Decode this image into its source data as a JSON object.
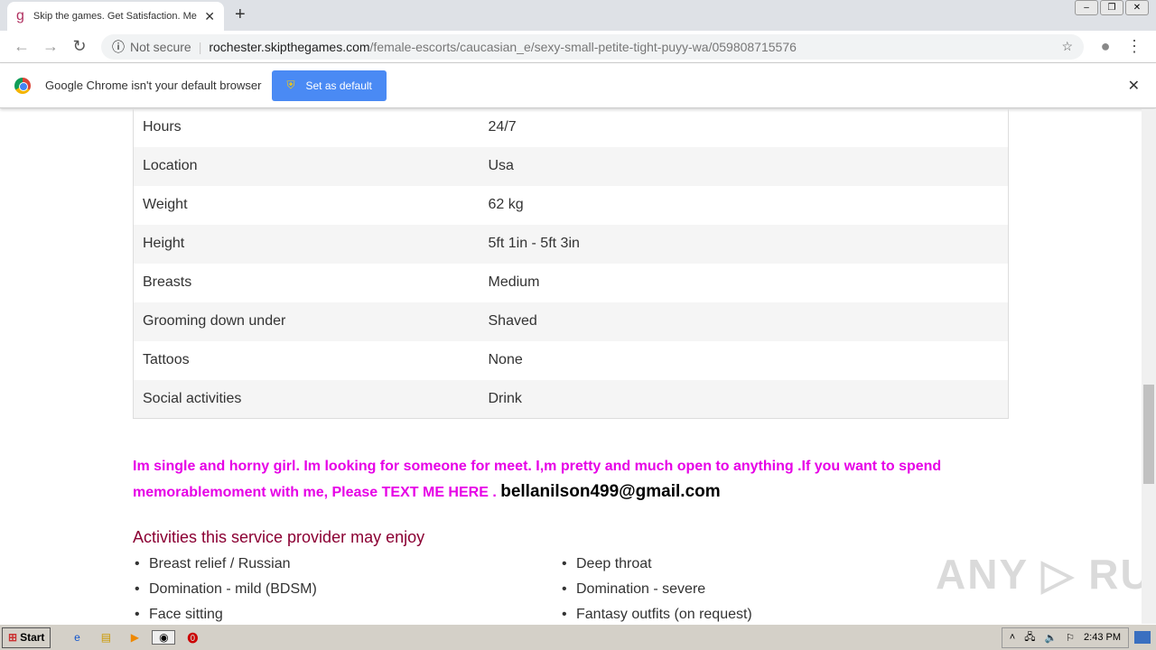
{
  "browser": {
    "tab_title": "Skip the games. Get Satisfaction. Me",
    "favicon": "g",
    "security": "Not secure",
    "url_host": "rochester.skipthegames.com",
    "url_path": "/female-escorts/caucasian_e/sexy-small-petite-tight-puyy-wa/059808715576"
  },
  "infobar": {
    "text": "Google Chrome isn't your default browser",
    "button": "Set as default"
  },
  "details": [
    {
      "label": "Hours",
      "value": "24/7"
    },
    {
      "label": "Location",
      "value": "Usa"
    },
    {
      "label": "Weight",
      "value": "62 kg"
    },
    {
      "label": "Height",
      "value": "5ft 1in - 5ft 3in"
    },
    {
      "label": "Breasts",
      "value": "Medium"
    },
    {
      "label": "Grooming down under",
      "value": "Shaved"
    },
    {
      "label": "Tattoos",
      "value": "None"
    },
    {
      "label": "Social activities",
      "value": "Drink"
    }
  ],
  "message": {
    "text": "Im single and horny girl. Im looking for someone for meet. I,m pretty and much open to anything .If you want to spend memorablemoment with me, Please TEXT ME HERE . ",
    "email": "bellanilson499@gmail.com"
  },
  "activities": {
    "heading": "Activities this service provider may enjoy",
    "items": [
      "Breast relief / Russian",
      "Deep throat",
      "Domination - mild (BDSM)",
      "Domination - severe",
      "Face sitting",
      "Fantasy outfits (on request)"
    ]
  },
  "watermark": "ANY RUN",
  "taskbar": {
    "start": "Start",
    "time": "2:43 PM"
  }
}
